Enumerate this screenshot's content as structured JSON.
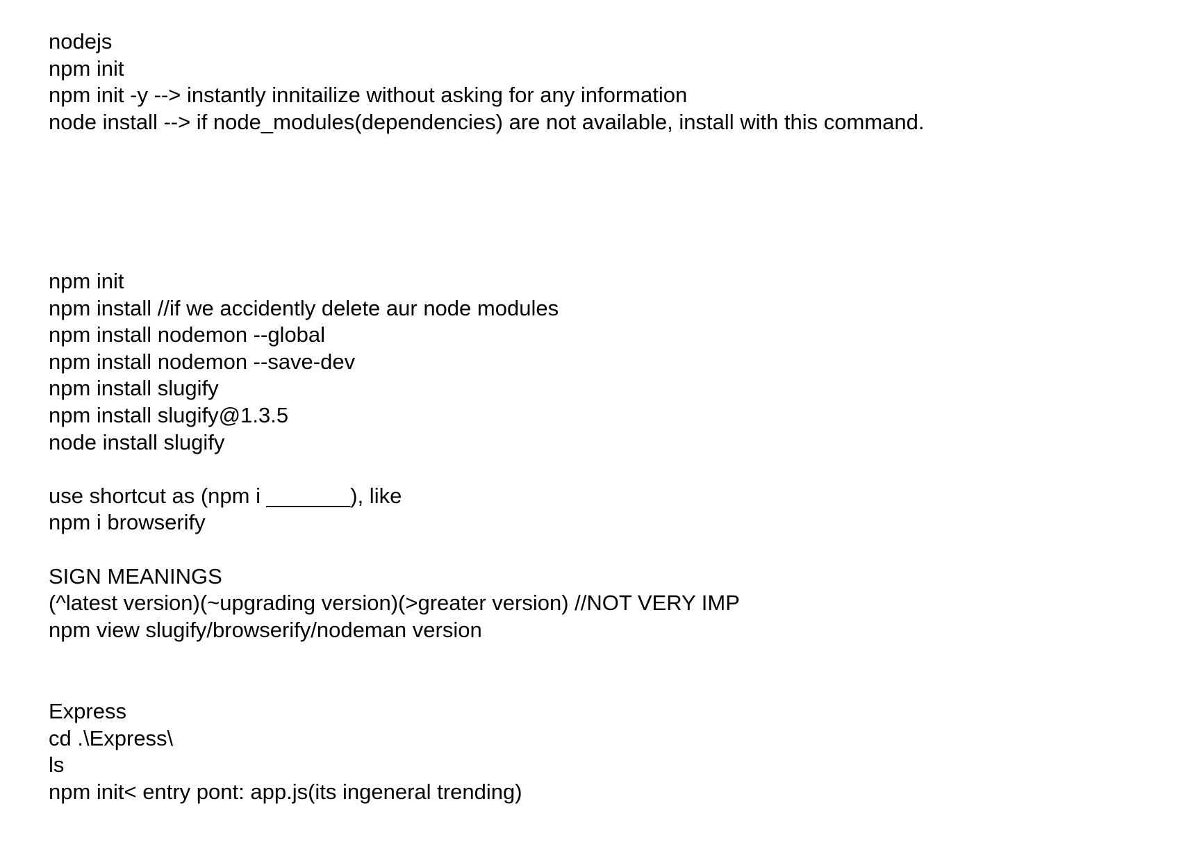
{
  "document": {
    "section_1": [
      "nodejs",
      "npm init",
      "npm init -y --> instantly innitailize without asking for any information",
      "node install --> if node_modules(dependencies) are not available, install with this command."
    ],
    "section_2": {
      "install_lines": [
        "npm init",
        "npm install //if we accidently delete aur node modules",
        "npm install nodemon --global",
        "npm install nodemon --save-dev",
        "npm install slugify",
        "npm install slugify@1.3.5",
        "node install slugify"
      ],
      "shortcut_lines": [
        "use shortcut as (npm i _______), like",
        "npm i browserify"
      ],
      "sign_lines": [
        "SIGN MEANINGS",
        "(^latest version)(~upgrading version)(>greater version) //NOT VERY IMP",
        "npm view slugify/browserify/nodeman version"
      ]
    },
    "section_3": [
      "Express",
      "cd .\\Express\\",
      "ls",
      "npm init< entry pont: app.js(its ingeneral trending)"
    ]
  }
}
